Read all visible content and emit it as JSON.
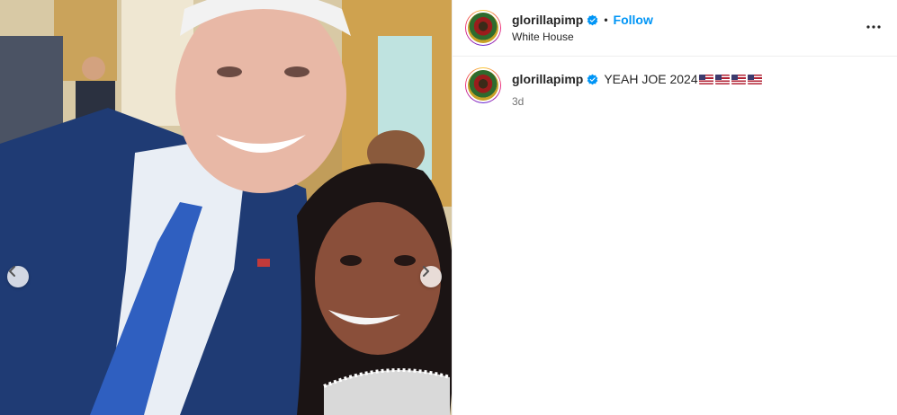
{
  "post": {
    "media": {
      "description_alt": "",
      "prev_icon": "chevron-left-icon",
      "next_icon": "chevron-right-icon"
    },
    "header": {
      "username": "glorillapimp",
      "verified_icon": "verified-badge-icon",
      "separator": "•",
      "follow_label": "Follow",
      "location": "White House",
      "more_icon": "more-options-icon"
    },
    "caption": {
      "username": "glorillapimp",
      "text": "YEAH JOE 2024",
      "emoji_icons": [
        "us-flag-icon",
        "us-flag-icon",
        "us-flag-icon",
        "us-flag-icon"
      ],
      "time": "3d"
    }
  },
  "colors": {
    "accent": "#0095f6",
    "verified": "#0095f6",
    "muted": "#737373",
    "border": "#efefef"
  }
}
